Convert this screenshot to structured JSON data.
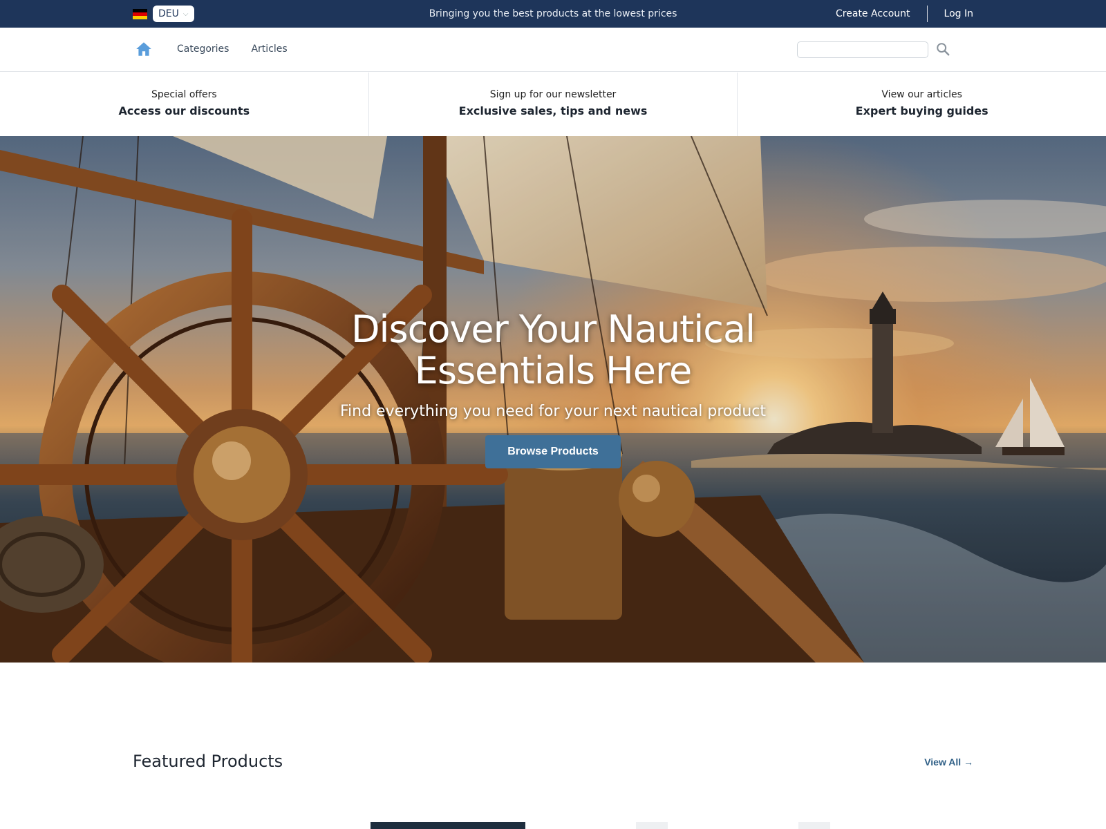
{
  "topbar": {
    "language": "DEU",
    "tagline": "Bringing you the best products at the lowest prices",
    "create_account": "Create Account",
    "log_in": "Log In",
    "colors": {
      "background": "#1e355a"
    }
  },
  "nav": {
    "home_icon": "home-icon",
    "links": [
      "Categories",
      "Articles"
    ],
    "search": {
      "value": "",
      "placeholder": "",
      "icon": "search-icon"
    }
  },
  "promos": [
    {
      "line1": "Special offers",
      "line2": "Access our discounts"
    },
    {
      "line1": "Sign up for our newsletter",
      "line2": "Exclusive sales, tips and news"
    },
    {
      "line1": "View our articles",
      "line2": "Expert buying guides"
    }
  ],
  "hero": {
    "title": "Discover Your Nautical Essentials Here",
    "subtitle": "Find everything you need for your next nautical product",
    "button": "Browse Products",
    "accent": "#3f7098"
  },
  "featured": {
    "title": "Featured Products",
    "view_all": "View All →"
  }
}
